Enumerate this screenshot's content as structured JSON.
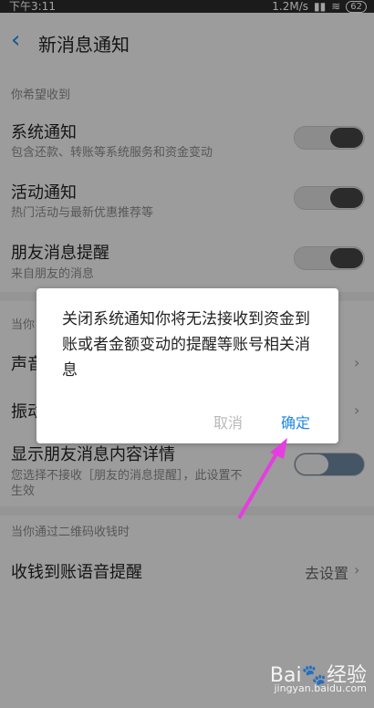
{
  "statusbar": {
    "time": "下午3:11",
    "speed": "1.2M/s",
    "battery": "62"
  },
  "header": {
    "title": "新消息通知"
  },
  "sections": {
    "receive_label": "你希望收到",
    "lock_label": "当你",
    "qr_label": "当你通过二维码收钱时"
  },
  "rows": [
    {
      "title": "系统通知",
      "subtitle": "包含还款、转账等系统服务和资金变动"
    },
    {
      "title": "活动通知",
      "subtitle": "热门活动与最新优惠推荐等"
    },
    {
      "title": "朋友消息提醒",
      "subtitle": "来自朋友的消息"
    },
    {
      "title": "声音"
    },
    {
      "title": "振动"
    },
    {
      "title": "显示朋友消息内容详情",
      "subtitle": "您选择不接收［朋友的消息提醒］，此设置不",
      "subtitle2": "生效"
    },
    {
      "title": "收钱到账语音提醒",
      "value": "去设置"
    }
  ],
  "dialog": {
    "message": "关闭系统通知你将无法接收到资金到账或者金额变动的提醒等账号相关消息",
    "cancel": "取消",
    "confirm": "确定"
  },
  "watermark": {
    "brand": "Bai🐾经验",
    "url": "jingyan.baidu.com"
  },
  "colors": {
    "accent": "#1e88e5",
    "arrow": "#e63de0"
  }
}
